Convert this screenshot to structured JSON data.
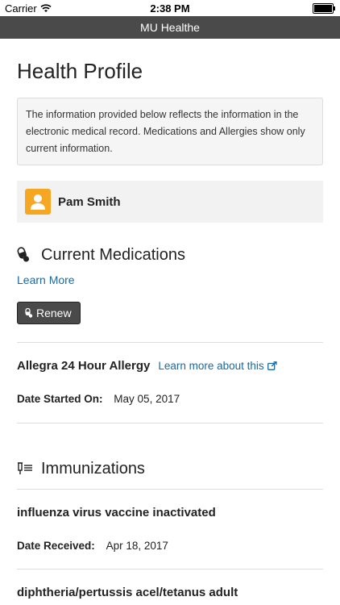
{
  "status_bar": {
    "carrier": "Carrier",
    "time": "2:38 PM"
  },
  "app_bar": {
    "title": "MU Healthe"
  },
  "page": {
    "title": "Health Profile",
    "info": "The information provided below reflects the information in the electronic medical record. Medications and Allergies show only current information."
  },
  "patient": {
    "name": "Pam Smith",
    "avatar_color": "#f5a623"
  },
  "medications": {
    "heading": "Current Medications",
    "learn_more": "Learn More",
    "renew_label": "Renew",
    "items": [
      {
        "name": "Allegra 24 Hour Allergy",
        "link": "Learn more about this",
        "date_key": "Date Started On:",
        "date_value": "May 05, 2017"
      }
    ]
  },
  "immunizations": {
    "heading": "Immunizations",
    "items": [
      {
        "name": "influenza virus vaccine inactivated",
        "date_key": "Date Received:",
        "date_value": "Apr 18, 2017"
      },
      {
        "name": "diphtheria/pertussis acel/tetanus adult"
      }
    ]
  },
  "colors": {
    "app_bar": "#4a4a4a",
    "link": "#1a6aa0",
    "button": "#4a4a4a"
  }
}
